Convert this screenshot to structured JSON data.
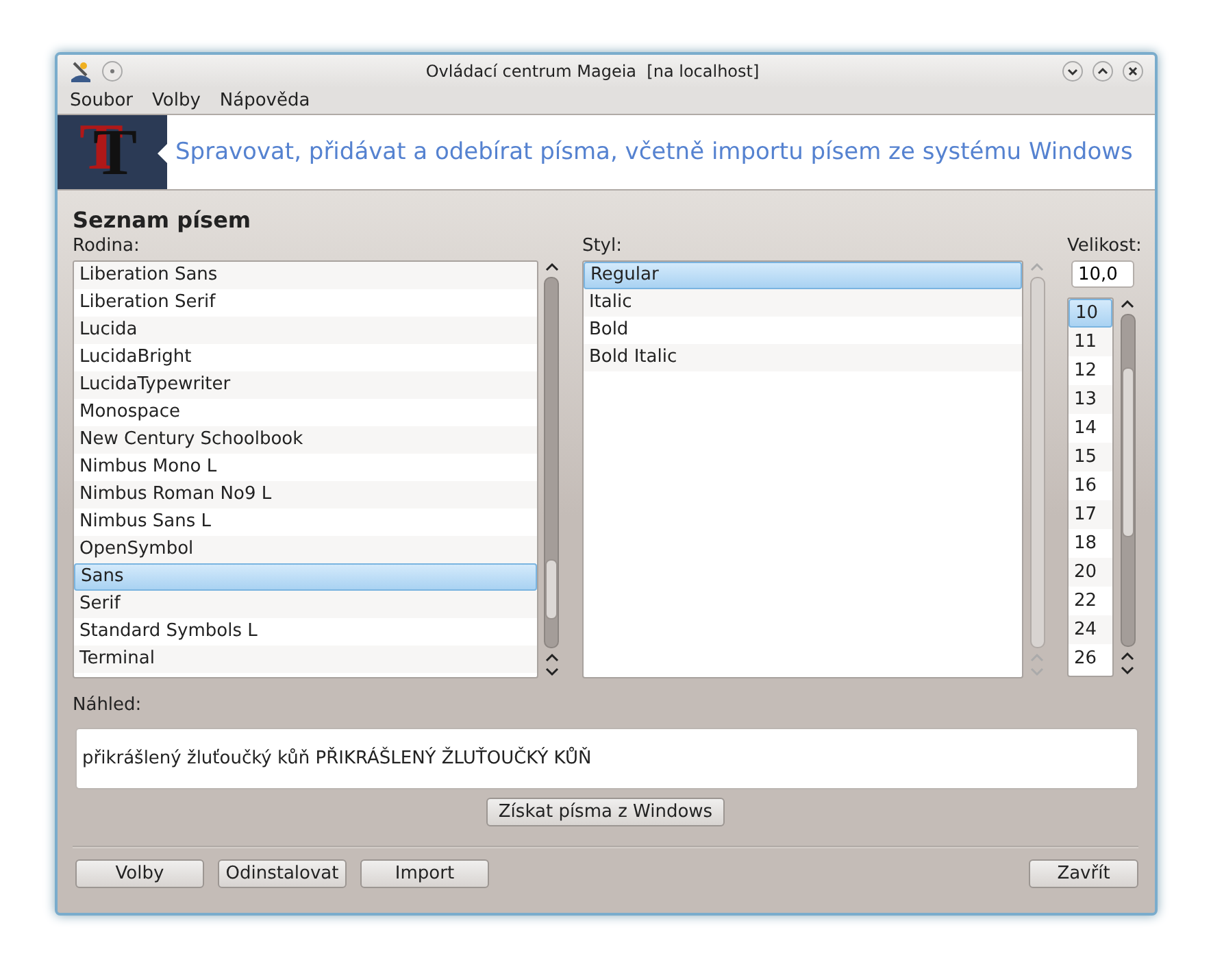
{
  "window": {
    "title": "Ovládací centrum Mageia  [na localhost]"
  },
  "menu": [
    "Soubor",
    "Volby",
    "Nápověda"
  ],
  "banner": {
    "logo": "T",
    "text": "Spravovat, přidávat a odebírat písma, včetně importu písem ze systému Windows"
  },
  "heading": "Seznam písem",
  "family": {
    "label": "Rodina:",
    "items": [
      {
        "name": "Liberation Sans",
        "selected": false
      },
      {
        "name": "Liberation Serif",
        "selected": false
      },
      {
        "name": "Lucida",
        "selected": false
      },
      {
        "name": "LucidaBright",
        "selected": false
      },
      {
        "name": "LucidaTypewriter",
        "selected": false
      },
      {
        "name": "Monospace",
        "selected": false
      },
      {
        "name": "New Century Schoolbook",
        "selected": false
      },
      {
        "name": "Nimbus Mono L",
        "selected": false
      },
      {
        "name": "Nimbus Roman No9 L",
        "selected": false
      },
      {
        "name": "Nimbus Sans L",
        "selected": false
      },
      {
        "name": "OpenSymbol",
        "selected": false
      },
      {
        "name": "Sans",
        "selected": true
      },
      {
        "name": "Serif",
        "selected": false
      },
      {
        "name": "Standard Symbols L",
        "selected": false
      },
      {
        "name": "Terminal",
        "selected": false
      }
    ]
  },
  "style": {
    "label": "Styl:",
    "items": [
      {
        "name": "Regular",
        "selected": true
      },
      {
        "name": "Italic",
        "selected": false
      },
      {
        "name": "Bold",
        "selected": false
      },
      {
        "name": "Bold Italic",
        "selected": false
      }
    ]
  },
  "size": {
    "label": "Velikost:",
    "value": "10,0",
    "items": [
      {
        "name": "10",
        "selected": true
      },
      {
        "name": "11",
        "selected": false
      },
      {
        "name": "12",
        "selected": false
      },
      {
        "name": "13",
        "selected": false
      },
      {
        "name": "14",
        "selected": false
      },
      {
        "name": "15",
        "selected": false
      },
      {
        "name": "16",
        "selected": false
      },
      {
        "name": "17",
        "selected": false
      },
      {
        "name": "18",
        "selected": false
      },
      {
        "name": "20",
        "selected": false
      },
      {
        "name": "22",
        "selected": false
      },
      {
        "name": "24",
        "selected": false
      },
      {
        "name": "26",
        "selected": false
      }
    ]
  },
  "preview": {
    "label": "Náhled:",
    "text": "přikrášlený žluťoučký kůň PŘIKRÁŠLENÝ ŽLUŤOUČKÝ KŮŇ"
  },
  "import_button": "Získat písma z Windows",
  "buttons": [
    "Volby",
    "Odinstalovat",
    "Import"
  ],
  "close_button": "Zavřít"
}
